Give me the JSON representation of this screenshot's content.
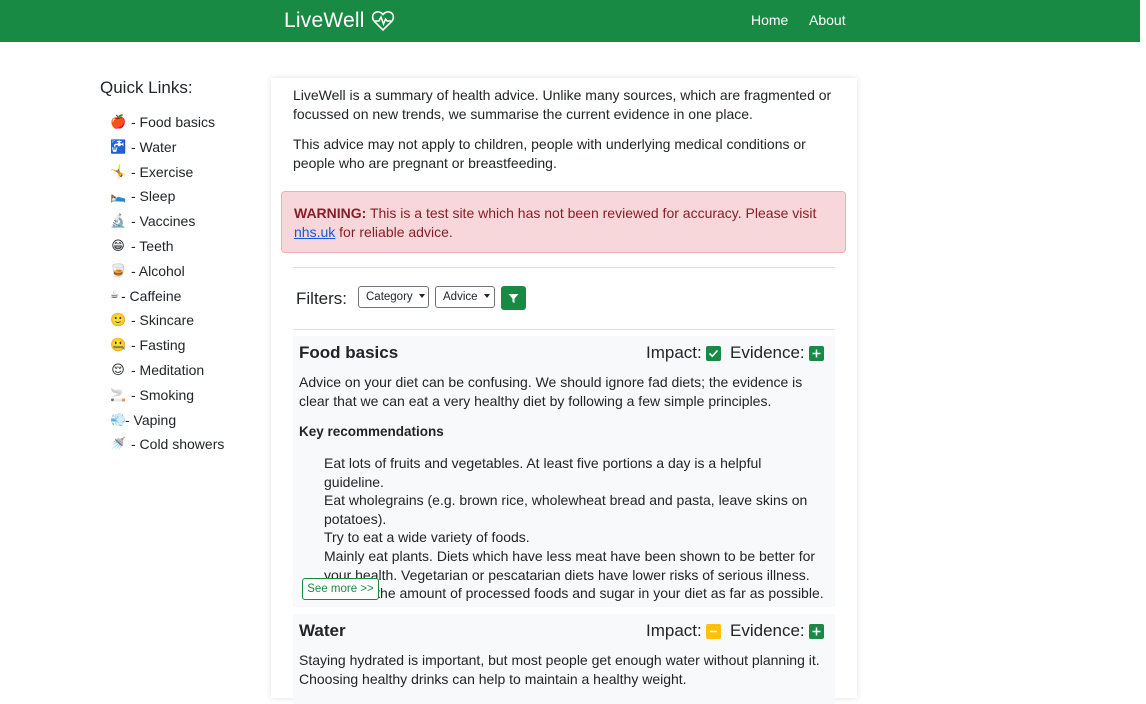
{
  "header": {
    "brand": "LiveWell",
    "nav": [
      {
        "label": "Home"
      },
      {
        "label": "About"
      }
    ],
    "bg_color": "#198a44"
  },
  "sidebar": {
    "title": "Quick Links:",
    "items": [
      {
        "emoji": "🍎",
        "label": "- Food basics"
      },
      {
        "emoji": "🚰",
        "label": "- Water"
      },
      {
        "emoji": "🤸",
        "label": "- Exercise"
      },
      {
        "emoji": "🛌",
        "label": "- Sleep"
      },
      {
        "emoji": "🔬",
        "label": "- Vaccines"
      },
      {
        "emoji": "😁",
        "label": "- Teeth"
      },
      {
        "emoji": "🥃",
        "label": "- Alcohol"
      },
      {
        "emoji": "☕",
        "label": "- Caffeine"
      },
      {
        "emoji": "🙂",
        "label": "- Skincare"
      },
      {
        "emoji": "🤐",
        "label": "- Fasting"
      },
      {
        "emoji": "😌",
        "label": "- Meditation"
      },
      {
        "emoji": "🚬",
        "label": "- Smoking"
      },
      {
        "emoji": "💨",
        "label": "- Vaping"
      },
      {
        "emoji": "🚿",
        "label": "- Cold showers"
      }
    ]
  },
  "intro": {
    "p1": "LiveWell is a summary of health advice. Unlike many sources, which are fragmented or focussed on new trends, we summarise the current evidence in one place.",
    "p2": "This advice may not apply to children, people with underlying medical conditions or people who are pregnant or breastfeeding."
  },
  "warning": {
    "label": "WARNING:",
    "text": "This is a test site which has not been reviewed for accuracy. Please visit",
    "link": "nhs.uk",
    "tail": "for reliable advice."
  },
  "filters": {
    "label": "Filters:",
    "category": "Category",
    "advice": "Advice"
  },
  "topics": [
    {
      "title": "Food basics",
      "impact_label": "Impact:",
      "evidence_label": "Evidence:",
      "impact_icon": "check-icon",
      "evidence_icon": "plus-icon",
      "description": "Advice on your diet can be confusing. We should ignore fad diets; the evidence is clear that we can eat a very healthy diet by following a few simple principles.",
      "key_title": "Key recommendations",
      "recommendations": [
        "Eat lots of fruits and vegetables. At least five portions a day is a helpful guideline.",
        "Eat wholegrains (e.g. brown rice, wholewheat bread and pasta, leave skins on potatoes).",
        "Try to eat a wide variety of foods.",
        "Mainly eat plants. Diets which have less meat have been shown to be better for your health. Vegetarian or pescatarian diets have lower risks of serious illness.",
        "Reduce the amount of processed foods and sugar in your diet as far as possible."
      ],
      "see_more": "See more >>"
    },
    {
      "title": "Water",
      "impact_label": "Impact:",
      "evidence_label": "Evidence:",
      "impact_icon": "minus-icon",
      "evidence_icon": "plus-icon",
      "description": "Staying hydrated is important, but most people get enough water without planning it. Choosing healthy drinks can help to maintain a healthy weight."
    }
  ],
  "colors": {
    "green": "#198a44",
    "yellow": "#ffc107",
    "warning_bg": "#f8d7da",
    "warning_text": "#842029"
  }
}
